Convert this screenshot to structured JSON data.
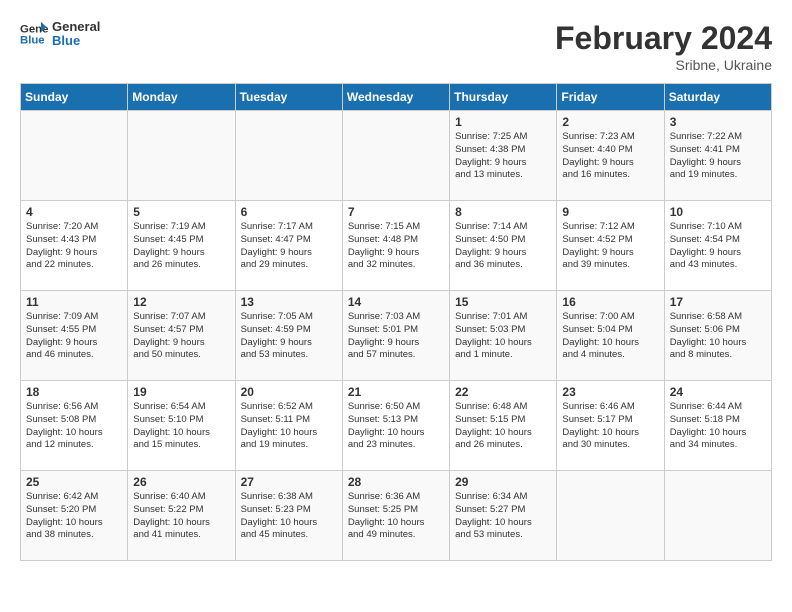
{
  "logo": {
    "line1": "General",
    "line2": "Blue"
  },
  "title": "February 2024",
  "subtitle": "Sribne, Ukraine",
  "days_of_week": [
    "Sunday",
    "Monday",
    "Tuesday",
    "Wednesday",
    "Thursday",
    "Friday",
    "Saturday"
  ],
  "weeks": [
    [
      {
        "day": "",
        "info": ""
      },
      {
        "day": "",
        "info": ""
      },
      {
        "day": "",
        "info": ""
      },
      {
        "day": "",
        "info": ""
      },
      {
        "day": "1",
        "info": "Sunrise: 7:25 AM\nSunset: 4:38 PM\nDaylight: 9 hours\nand 13 minutes."
      },
      {
        "day": "2",
        "info": "Sunrise: 7:23 AM\nSunset: 4:40 PM\nDaylight: 9 hours\nand 16 minutes."
      },
      {
        "day": "3",
        "info": "Sunrise: 7:22 AM\nSunset: 4:41 PM\nDaylight: 9 hours\nand 19 minutes."
      }
    ],
    [
      {
        "day": "4",
        "info": "Sunrise: 7:20 AM\nSunset: 4:43 PM\nDaylight: 9 hours\nand 22 minutes."
      },
      {
        "day": "5",
        "info": "Sunrise: 7:19 AM\nSunset: 4:45 PM\nDaylight: 9 hours\nand 26 minutes."
      },
      {
        "day": "6",
        "info": "Sunrise: 7:17 AM\nSunset: 4:47 PM\nDaylight: 9 hours\nand 29 minutes."
      },
      {
        "day": "7",
        "info": "Sunrise: 7:15 AM\nSunset: 4:48 PM\nDaylight: 9 hours\nand 32 minutes."
      },
      {
        "day": "8",
        "info": "Sunrise: 7:14 AM\nSunset: 4:50 PM\nDaylight: 9 hours\nand 36 minutes."
      },
      {
        "day": "9",
        "info": "Sunrise: 7:12 AM\nSunset: 4:52 PM\nDaylight: 9 hours\nand 39 minutes."
      },
      {
        "day": "10",
        "info": "Sunrise: 7:10 AM\nSunset: 4:54 PM\nDaylight: 9 hours\nand 43 minutes."
      }
    ],
    [
      {
        "day": "11",
        "info": "Sunrise: 7:09 AM\nSunset: 4:55 PM\nDaylight: 9 hours\nand 46 minutes."
      },
      {
        "day": "12",
        "info": "Sunrise: 7:07 AM\nSunset: 4:57 PM\nDaylight: 9 hours\nand 50 minutes."
      },
      {
        "day": "13",
        "info": "Sunrise: 7:05 AM\nSunset: 4:59 PM\nDaylight: 9 hours\nand 53 minutes."
      },
      {
        "day": "14",
        "info": "Sunrise: 7:03 AM\nSunset: 5:01 PM\nDaylight: 9 hours\nand 57 minutes."
      },
      {
        "day": "15",
        "info": "Sunrise: 7:01 AM\nSunset: 5:03 PM\nDaylight: 10 hours\nand 1 minute."
      },
      {
        "day": "16",
        "info": "Sunrise: 7:00 AM\nSunset: 5:04 PM\nDaylight: 10 hours\nand 4 minutes."
      },
      {
        "day": "17",
        "info": "Sunrise: 6:58 AM\nSunset: 5:06 PM\nDaylight: 10 hours\nand 8 minutes."
      }
    ],
    [
      {
        "day": "18",
        "info": "Sunrise: 6:56 AM\nSunset: 5:08 PM\nDaylight: 10 hours\nand 12 minutes."
      },
      {
        "day": "19",
        "info": "Sunrise: 6:54 AM\nSunset: 5:10 PM\nDaylight: 10 hours\nand 15 minutes."
      },
      {
        "day": "20",
        "info": "Sunrise: 6:52 AM\nSunset: 5:11 PM\nDaylight: 10 hours\nand 19 minutes."
      },
      {
        "day": "21",
        "info": "Sunrise: 6:50 AM\nSunset: 5:13 PM\nDaylight: 10 hours\nand 23 minutes."
      },
      {
        "day": "22",
        "info": "Sunrise: 6:48 AM\nSunset: 5:15 PM\nDaylight: 10 hours\nand 26 minutes."
      },
      {
        "day": "23",
        "info": "Sunrise: 6:46 AM\nSunset: 5:17 PM\nDaylight: 10 hours\nand 30 minutes."
      },
      {
        "day": "24",
        "info": "Sunrise: 6:44 AM\nSunset: 5:18 PM\nDaylight: 10 hours\nand 34 minutes."
      }
    ],
    [
      {
        "day": "25",
        "info": "Sunrise: 6:42 AM\nSunset: 5:20 PM\nDaylight: 10 hours\nand 38 minutes."
      },
      {
        "day": "26",
        "info": "Sunrise: 6:40 AM\nSunset: 5:22 PM\nDaylight: 10 hours\nand 41 minutes."
      },
      {
        "day": "27",
        "info": "Sunrise: 6:38 AM\nSunset: 5:23 PM\nDaylight: 10 hours\nand 45 minutes."
      },
      {
        "day": "28",
        "info": "Sunrise: 6:36 AM\nSunset: 5:25 PM\nDaylight: 10 hours\nand 49 minutes."
      },
      {
        "day": "29",
        "info": "Sunrise: 6:34 AM\nSunset: 5:27 PM\nDaylight: 10 hours\nand 53 minutes."
      },
      {
        "day": "",
        "info": ""
      },
      {
        "day": "",
        "info": ""
      }
    ]
  ]
}
